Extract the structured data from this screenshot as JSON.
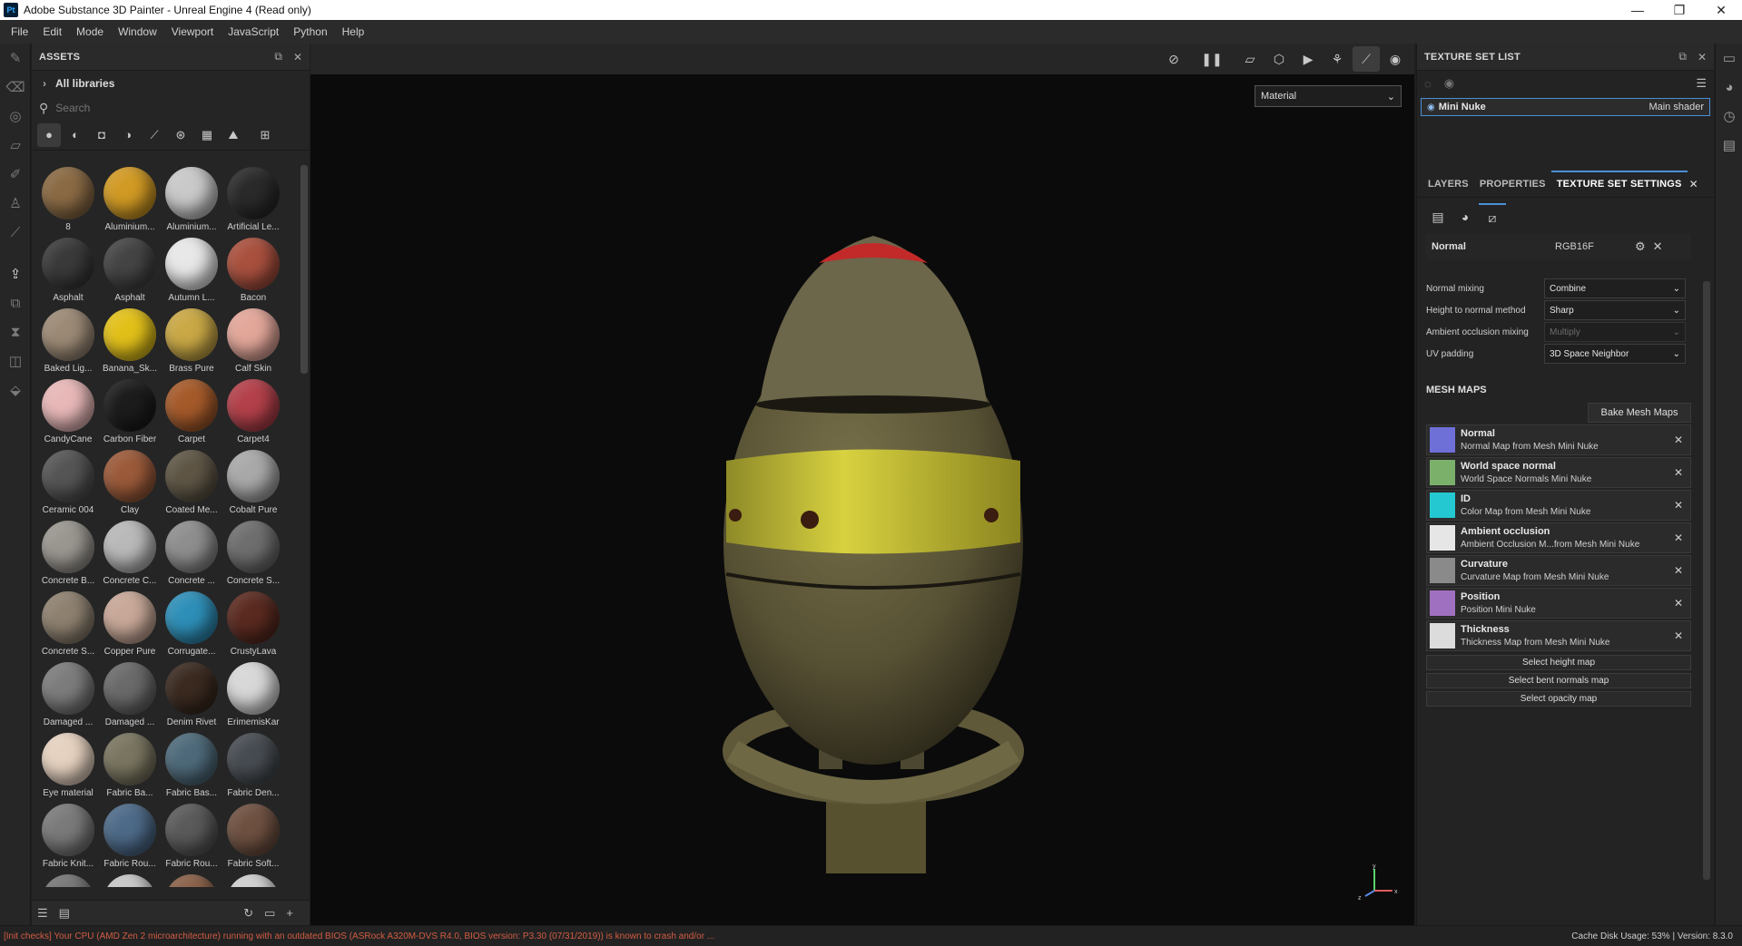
{
  "window": {
    "app_icon": "Pt",
    "title": "Adobe Substance 3D Painter - Unreal Engine 4 (Read only)",
    "minimize": "—",
    "maximize": "❐",
    "close": "✕"
  },
  "menu": [
    "File",
    "Edit",
    "Mode",
    "Window",
    "Viewport",
    "JavaScript",
    "Python",
    "Help"
  ],
  "assets": {
    "title": "ASSETS",
    "library": "All libraries",
    "search_placeholder": "Search",
    "items": [
      {
        "label": "8",
        "color": "#8a6a44"
      },
      {
        "label": "Aluminium...",
        "color": "#d19a24"
      },
      {
        "label": "Aluminium...",
        "color": "#c9c9c9"
      },
      {
        "label": "Artificial Le...",
        "color": "#2a2a2a"
      },
      {
        "label": "Asphalt",
        "color": "#3a3a3a"
      },
      {
        "label": "Asphalt",
        "color": "#444444"
      },
      {
        "label": "Autumn L...",
        "color": "#e8e8e8"
      },
      {
        "label": "Bacon",
        "color": "#a9503e"
      },
      {
        "label": "Baked Lig...",
        "color": "#9c8a76"
      },
      {
        "label": "Banana_Sk...",
        "color": "#e2c01a"
      },
      {
        "label": "Brass Pure",
        "color": "#c9a845"
      },
      {
        "label": "Calf Skin",
        "color": "#e3a79a"
      },
      {
        "label": "CandyCane",
        "color": "#e8b8b8"
      },
      {
        "label": "Carbon Fiber",
        "color": "#1c1c1c"
      },
      {
        "label": "Carpet",
        "color": "#a55a2a"
      },
      {
        "label": "Carpet4",
        "color": "#b3404a"
      },
      {
        "label": "Ceramic 004",
        "color": "#555555"
      },
      {
        "label": "Clay",
        "color": "#9b5a3a"
      },
      {
        "label": "Coated Me...",
        "color": "#5e5545"
      },
      {
        "label": "Cobalt Pure",
        "color": "#a9a9a9"
      },
      {
        "label": "Concrete B...",
        "color": "#9a9690"
      },
      {
        "label": "Concrete C...",
        "color": "#b9b9b9"
      },
      {
        "label": "Concrete ...",
        "color": "#8e8e8e"
      },
      {
        "label": "Concrete S...",
        "color": "#6e6e6e"
      },
      {
        "label": "Concrete S...",
        "color": "#8e8170"
      },
      {
        "label": "Copper Pure",
        "color": "#c8a898"
      },
      {
        "label": "Corrugate...",
        "color": "#2e8fb8"
      },
      {
        "label": "CrustyLava",
        "color": "#5a2a20"
      },
      {
        "label": "Damaged ...",
        "color": "#7c7c7c"
      },
      {
        "label": "Damaged ...",
        "color": "#6a6a6a"
      },
      {
        "label": "Denim Rivet",
        "color": "#3a2a20"
      },
      {
        "label": "ErimemisKar",
        "color": "#d8d8d8"
      },
      {
        "label": "Eye material",
        "color": "#e6d2c0"
      },
      {
        "label": "Fabric Ba...",
        "color": "#7a7560"
      },
      {
        "label": "Fabric Bas...",
        "color": "#4e6a7a"
      },
      {
        "label": "Fabric Den...",
        "color": "#474c52"
      },
      {
        "label": "Fabric Knit...",
        "color": "#7a7a7a"
      },
      {
        "label": "Fabric Rou...",
        "color": "#4d6a88"
      },
      {
        "label": "Fabric Rou...",
        "color": "#5a5a5a"
      },
      {
        "label": "Fabric Soft...",
        "color": "#6e5040"
      },
      {
        "label": "",
        "color": "#777777"
      },
      {
        "label": "",
        "color": "#c8c8c8"
      },
      {
        "label": "",
        "color": "#8a6048"
      },
      {
        "label": "",
        "color": "#d0d0d0"
      }
    ]
  },
  "viewport": {
    "view_mode": "Material",
    "axis_labels": {
      "y": "y",
      "x": "x",
      "z": "z"
    }
  },
  "texture_set_list": {
    "title": "TEXTURE SET LIST",
    "row": {
      "name": "Mini Nuke",
      "shader": "Main shader"
    }
  },
  "tabs": {
    "layers": "LAYERS",
    "properties": "PROPERTIES",
    "texture_set_settings": "TEXTURE SET SETTINGS"
  },
  "settings": {
    "normal_label": "Normal",
    "normal_format": "RGB16F",
    "rows": [
      {
        "label": "Normal mixing",
        "value": "Combine",
        "disabled": false
      },
      {
        "label": "Height to normal method",
        "value": "Sharp",
        "disabled": false
      },
      {
        "label": "Ambient occlusion mixing",
        "value": "Multiply",
        "disabled": true
      },
      {
        "label": "UV padding",
        "value": "3D Space Neighbor",
        "disabled": false
      }
    ],
    "mesh_maps_title": "MESH MAPS",
    "bake_button": "Bake Mesh Maps",
    "maps": [
      {
        "name": "Normal",
        "desc": "Normal Map from Mesh Mini Nuke",
        "thumb": "#6f6fd8"
      },
      {
        "name": "World space normal",
        "desc": "World Space Normals Mini Nuke",
        "thumb": "#7ab06a"
      },
      {
        "name": "ID",
        "desc": "Color Map from Mesh Mini Nuke",
        "thumb": "#23c8d0"
      },
      {
        "name": "Ambient occlusion",
        "desc": "Ambient Occlusion M...from Mesh Mini Nuke",
        "thumb": "#e6e6e6"
      },
      {
        "name": "Curvature",
        "desc": "Curvature Map from Mesh Mini Nuke",
        "thumb": "#8a8a8a"
      },
      {
        "name": "Position",
        "desc": "Position Mini Nuke",
        "thumb": "#a070c0"
      },
      {
        "name": "Thickness",
        "desc": "Thickness Map from Mesh Mini Nuke",
        "thumb": "#dcdcdc"
      }
    ],
    "select_buttons": [
      "Select height map",
      "Select bent normals map",
      "Select opacity map"
    ]
  },
  "status": {
    "warning": "[Init checks] Your CPU (AMD Zen 2 microarchitecture) running with an outdated BIOS (ASRock A320M-DVS R4.0, BIOS version: P3.30 (07/31/2019)) is known to crash and/or ...",
    "cache": "Cache Disk Usage:   53% | Version: 8.3.0"
  },
  "colors": {
    "accent": "#4b8fd8",
    "warning": "#d35c43",
    "nuke_yellow": "#c9c338",
    "nuke_body": "#5d5636",
    "nuke_cap": "#c22a2a"
  }
}
